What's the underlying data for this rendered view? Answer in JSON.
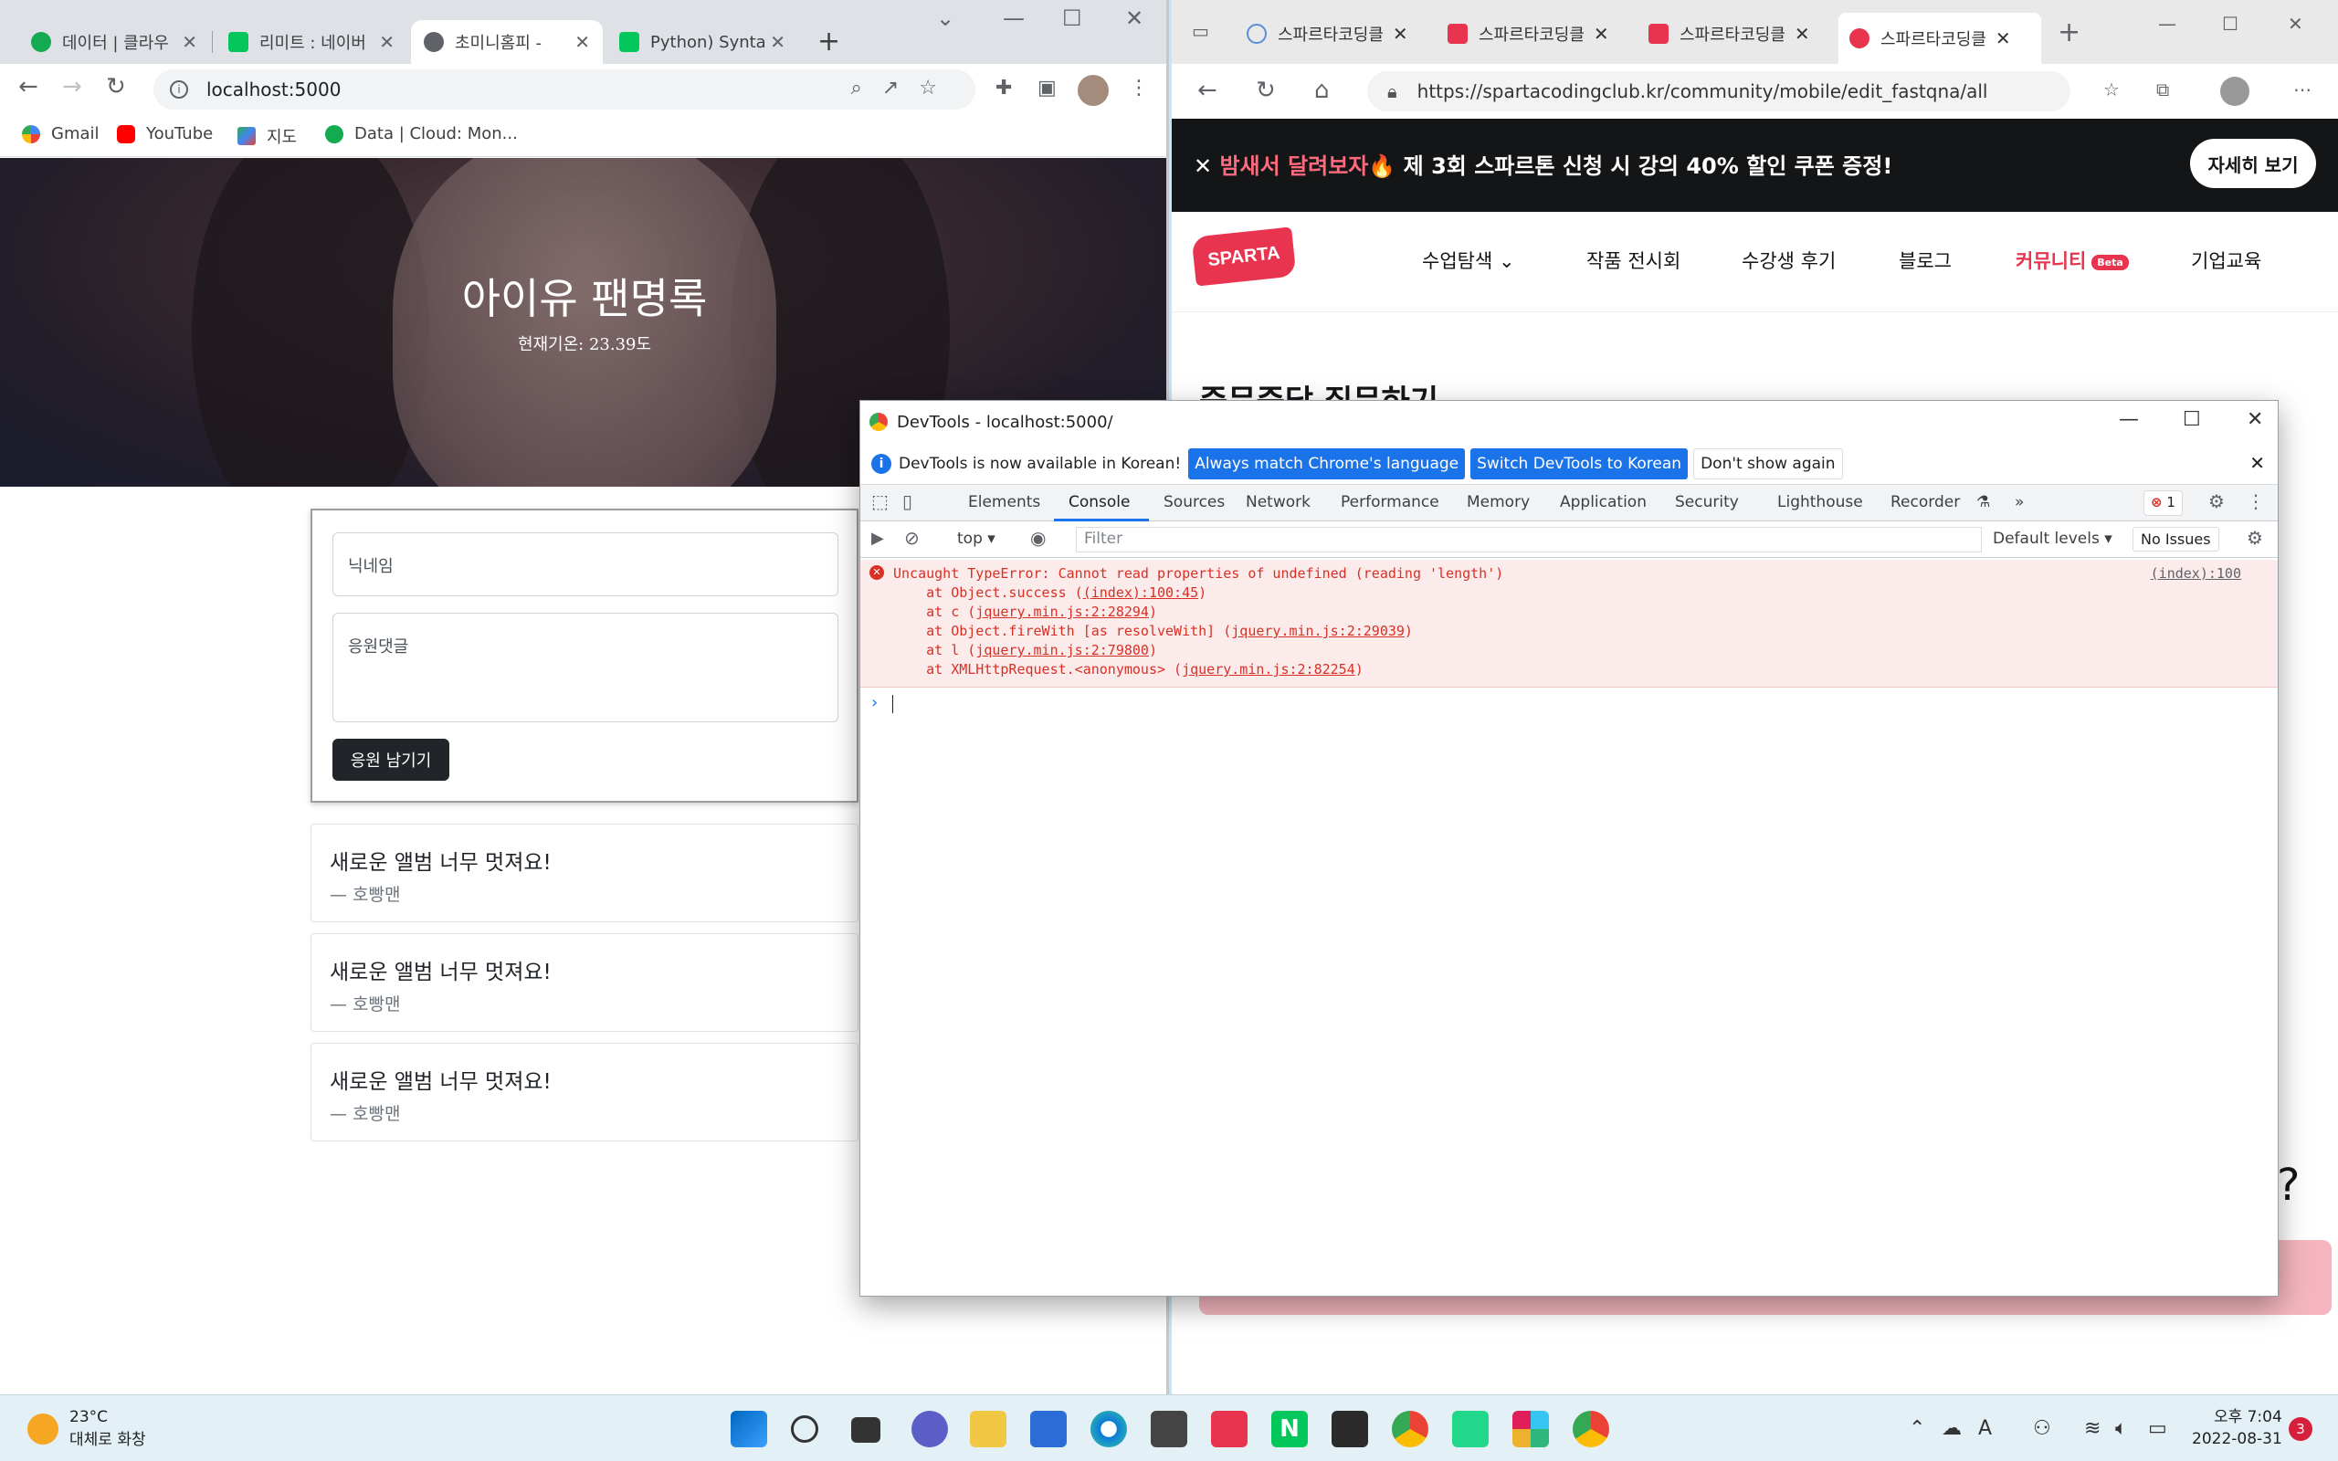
{
  "left_browser": {
    "tabs": [
      {
        "label": "데이터 | 클라우",
        "active": false
      },
      {
        "label": "리미트 : 네이버",
        "active": false
      },
      {
        "label": "초미니홈피 - ",
        "active": true
      },
      {
        "label": "Python) Syntax",
        "active": false
      }
    ],
    "url": "localhost:5000",
    "bookmarks": [
      "Gmail",
      "YouTube",
      "지도",
      "Data | Cloud: Mon..."
    ],
    "page": {
      "title": "아이유 팬명록",
      "temperature": "현재기온: 23.39도",
      "nickname_placeholder": "닉네임",
      "comment_placeholder": "응원댓글",
      "submit_label": "응원 남기기",
      "comments": [
        {
          "message": "새로운 앨범 너무 멋져요!",
          "author": "— 호빵맨"
        },
        {
          "message": "새로운 앨범 너무 멋져요!",
          "author": "— 호빵맨"
        },
        {
          "message": "새로운 앨범 너무 멋져요!",
          "author": "— 호빵맨"
        }
      ]
    }
  },
  "right_browser": {
    "tabs": [
      {
        "label": "스파르타코딩클",
        "active": false
      },
      {
        "label": "스파르타코딩클",
        "active": false
      },
      {
        "label": "스파르타코딩클",
        "active": false
      },
      {
        "label": "스파르타코딩클",
        "active": true
      }
    ],
    "url": "https://spartacodingclub.kr/community/mobile/edit_fastqna/all",
    "banner": {
      "highlight": "밤새서 달려보자🔥",
      "text": " 제 3회 스파르톤 신청 시 강의 40% 할인 쿠폰 증정!",
      "button": "자세히 보기"
    },
    "logo": "SPARTA",
    "nav": [
      "수업탐색",
      "작품 전시회",
      "수강생 후기",
      "블로그",
      "커뮤니티",
      "기업교육"
    ],
    "nav_badge": "Beta",
    "page_heading": "즉문즉답 질문하기"
  },
  "devtools": {
    "title": "DevTools - localhost:5000/",
    "infobar": {
      "message": "DevTools is now available in Korean!",
      "btn_match": "Always match Chrome's language",
      "btn_switch": "Switch DevTools to Korean",
      "btn_dismiss": "Don't show again"
    },
    "tabs": [
      "Elements",
      "Console",
      "Sources",
      "Network",
      "Performance",
      "Memory",
      "Application",
      "Security",
      "Lighthouse",
      "Recorder"
    ],
    "active_tab": "Console",
    "error_count": "1",
    "console": {
      "context": "top",
      "filter_placeholder": "Filter",
      "levels": "Default levels",
      "issues": "No Issues",
      "error_line": "Uncaught TypeError: Cannot read properties of undefined (reading 'length')",
      "error_source": "(index):100",
      "stack": [
        {
          "prefix": "    at Object.success (",
          "link": "(index):100:45",
          "suffix": ")"
        },
        {
          "prefix": "    at c (",
          "link": "jquery.min.js:2:28294",
          "suffix": ")"
        },
        {
          "prefix": "    at Object.fireWith [as resolveWith] (",
          "link": "jquery.min.js:2:29039",
          "suffix": ")"
        },
        {
          "prefix": "    at l (",
          "link": "jquery.min.js:2:79800",
          "suffix": ")"
        },
        {
          "prefix": "    at XMLHttpRequest.<anonymous> (",
          "link": "jquery.min.js:2:82254",
          "suffix": ")"
        }
      ]
    }
  },
  "taskbar": {
    "weather_temp": "23°C",
    "weather_desc": "대체로 화창",
    "time": "오후 7:04",
    "date": "2022-08-31",
    "notification_count": "3"
  }
}
